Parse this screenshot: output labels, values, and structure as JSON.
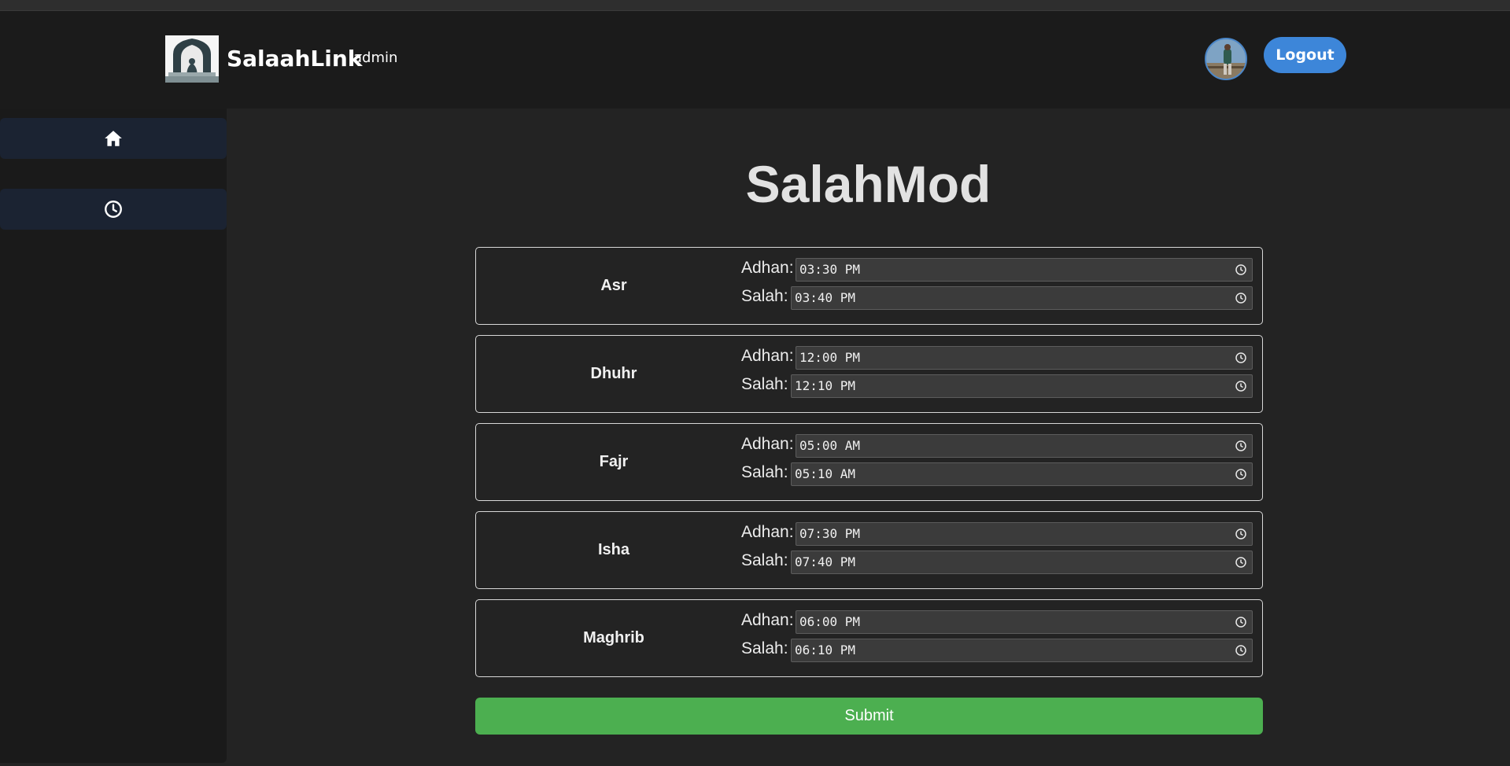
{
  "header": {
    "brand_name": "SalaahLink",
    "role": "admin",
    "logout_label": "Logout"
  },
  "sidebar": {
    "items": [
      {
        "icon": "home-icon"
      },
      {
        "icon": "clock-icon"
      }
    ]
  },
  "main": {
    "title": "SalahMod",
    "adhan_label": "Adhan:",
    "salah_label": "Salah:",
    "prayers": [
      {
        "name": "Asr",
        "adhan": "03:30 PM",
        "salah": "03:40 PM"
      },
      {
        "name": "Dhuhr",
        "adhan": "12:00 PM",
        "salah": "12:10 PM"
      },
      {
        "name": "Fajr",
        "adhan": "05:00 AM",
        "salah": "05:10 AM"
      },
      {
        "name": "Isha",
        "adhan": "07:30 PM",
        "salah": "07:40 PM"
      },
      {
        "name": "Maghrib",
        "adhan": "06:00 PM",
        "salah": "06:10 PM"
      }
    ],
    "submit_label": "Submit"
  },
  "colors": {
    "accent_blue": "#3d86d9",
    "submit_green": "#4caf50",
    "header_bg": "#1b1b1b",
    "page_bg": "#232323"
  }
}
